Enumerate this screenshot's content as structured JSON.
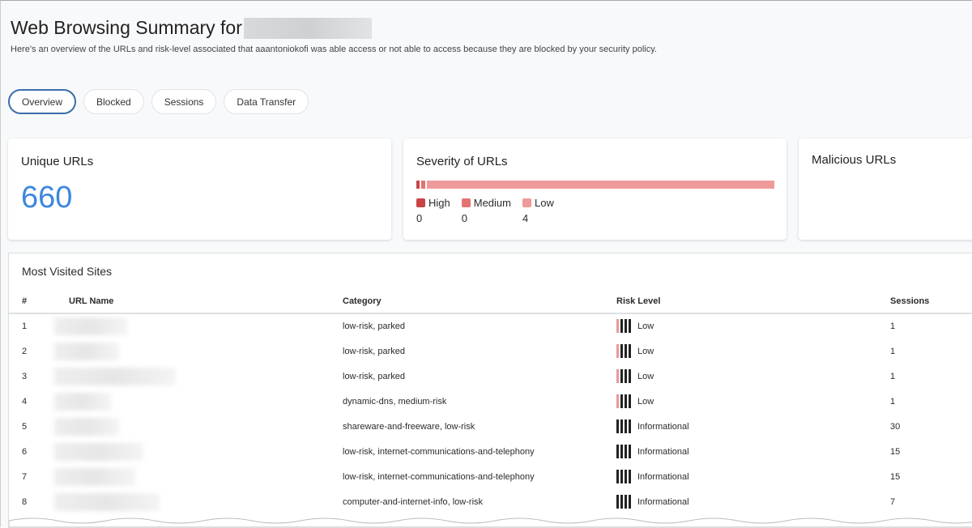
{
  "header": {
    "title": "Web Browsing Summary for",
    "subtitle": "Here's an overview of the URLs and risk-level associated that aaantoniokofi was able access or not able to access because they are blocked by your security policy."
  },
  "tabs": [
    {
      "label": "Overview",
      "active": true
    },
    {
      "label": "Blocked"
    },
    {
      "label": "Sessions"
    },
    {
      "label": "Data Transfer"
    }
  ],
  "unique_urls": {
    "title": "Unique URLs",
    "value": "660"
  },
  "severity": {
    "title": "Severity of URLs",
    "items": [
      {
        "label": "High",
        "value": "0",
        "color": "#c94545"
      },
      {
        "label": "Medium",
        "value": "0",
        "color": "#e57373"
      },
      {
        "label": "Low",
        "value": "4",
        "color": "#ef9a9a"
      }
    ]
  },
  "malicious": {
    "title": "Malicious URLs"
  },
  "sites": {
    "title": "Most Visited Sites",
    "columns": [
      "#",
      "URL Name",
      "Category",
      "Risk Level",
      "Sessions"
    ],
    "rows": [
      {
        "n": "1",
        "category": "low-risk, parked",
        "risk": "Low",
        "sessions": "1"
      },
      {
        "n": "2",
        "category": "low-risk, parked",
        "risk": "Low",
        "sessions": "1"
      },
      {
        "n": "3",
        "category": "low-risk, parked",
        "risk": "Low",
        "sessions": "1"
      },
      {
        "n": "4",
        "category": "dynamic-dns, medium-risk",
        "risk": "Low",
        "sessions": "1"
      },
      {
        "n": "5",
        "category": "shareware-and-freeware, low-risk",
        "risk": "Informational",
        "sessions": "30"
      },
      {
        "n": "6",
        "category": "low-risk, internet-communications-and-telephony",
        "risk": "Informational",
        "sessions": "15"
      },
      {
        "n": "7",
        "category": "low-risk, internet-communications-and-telephony",
        "risk": "Informational",
        "sessions": "15"
      },
      {
        "n": "8",
        "category": "computer-and-internet-info, low-risk",
        "risk": "Informational",
        "sessions": "7"
      }
    ]
  }
}
